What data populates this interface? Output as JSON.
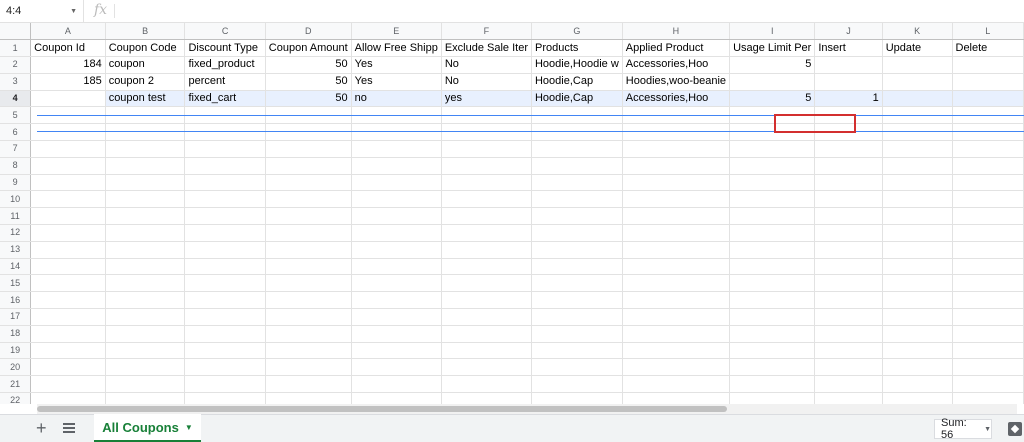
{
  "formula_bar": {
    "name_box": "4:4",
    "fx": "fx",
    "value": ""
  },
  "columns": [
    "A",
    "B",
    "C",
    "D",
    "E",
    "F",
    "G",
    "H",
    "I",
    "J",
    "K",
    "L"
  ],
  "row_numbers": [
    "1",
    "2",
    "3",
    "4",
    "5",
    "6",
    "7",
    "8",
    "9",
    "10",
    "11",
    "12",
    "13",
    "14",
    "15",
    "16",
    "17",
    "18",
    "19",
    "20",
    "21",
    "22"
  ],
  "rows": [
    [
      "Coupon Id",
      "Coupon Code",
      "Discount Type",
      "Coupon Amount",
      "Allow Free Shipp",
      "Exclude Sale Iter",
      "Products",
      "Applied Product",
      "Usage Limit Per",
      "Insert",
      "Update",
      "Delete"
    ],
    [
      "184",
      "coupon",
      "fixed_product",
      "50",
      "Yes",
      "No",
      "Hoodie,Hoodie w",
      "Accessories,Hoo",
      "5",
      "",
      "",
      ""
    ],
    [
      "185",
      "coupon 2",
      "percent",
      "50",
      "Yes",
      "No",
      "Hoodie,Cap",
      "Hoodies,woo-beanie",
      "",
      "",
      "",
      ""
    ],
    [
      "",
      "coupon test",
      "fixed_cart",
      "50",
      "no",
      "yes",
      "Hoodie,Cap",
      "Accessories,Hoo",
      "5",
      "1",
      "",
      ""
    ]
  ],
  "sheet_tab": {
    "label": "All Coupons"
  },
  "status": {
    "sum": "Sum: 56"
  },
  "colors": {
    "accent": "#188038",
    "selection": "#e8f0fe",
    "highlight_border": "#d32f2f"
  }
}
